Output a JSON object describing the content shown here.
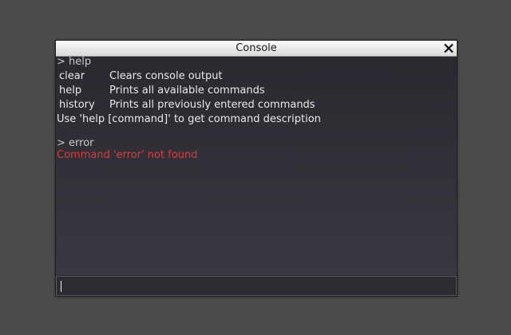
{
  "window": {
    "title": "Console"
  },
  "output": {
    "prompt_1": "> help",
    "commands": [
      {
        "name": "clear",
        "description": "Clears console output"
      },
      {
        "name": "help",
        "description": "Prints all available commands"
      },
      {
        "name": "history",
        "description": "Prints all previously entered commands"
      }
    ],
    "hint": "Use 'help [command]' to get command description",
    "prompt_2": "> error",
    "error": "Command 'error' not found"
  },
  "input": {
    "value": "",
    "placeholder": ""
  },
  "icons": {
    "close": "close-icon"
  },
  "colors": {
    "background": "#4b4b4b",
    "console_bg": "#2f2e35",
    "text": "#e8e8e8",
    "error": "#e0393a"
  }
}
